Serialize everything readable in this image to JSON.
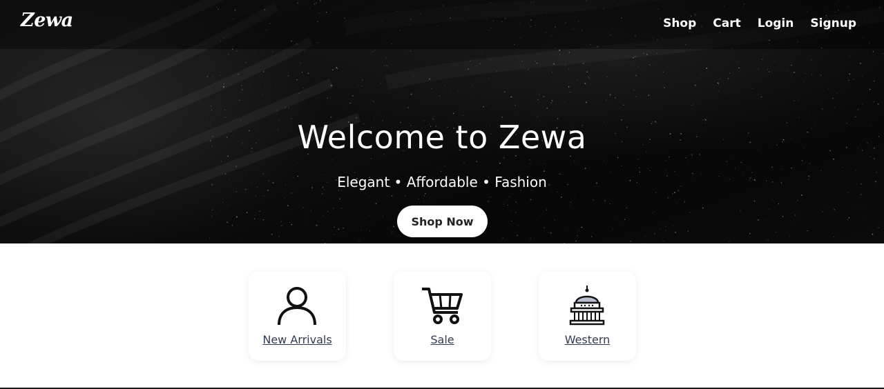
{
  "brand": {
    "name": "Zewa"
  },
  "nav": {
    "links": [
      "Shop",
      "Cart",
      "Login",
      "Signup"
    ]
  },
  "hero": {
    "title": "Welcome to Zewa",
    "subtitle": "Elegant • Affordable • Fashion",
    "cta_label": "Shop Now"
  },
  "categories": [
    {
      "label": "New Arrivals",
      "icon": "user-icon"
    },
    {
      "label": "Sale",
      "icon": "shopping-cart-icon"
    },
    {
      "label": "Western",
      "icon": "capitol-building-icon"
    }
  ],
  "colors": {
    "hero_bg": "#0a0a0a",
    "text_on_dark": "#ffffff",
    "link": "#2f3b52"
  }
}
